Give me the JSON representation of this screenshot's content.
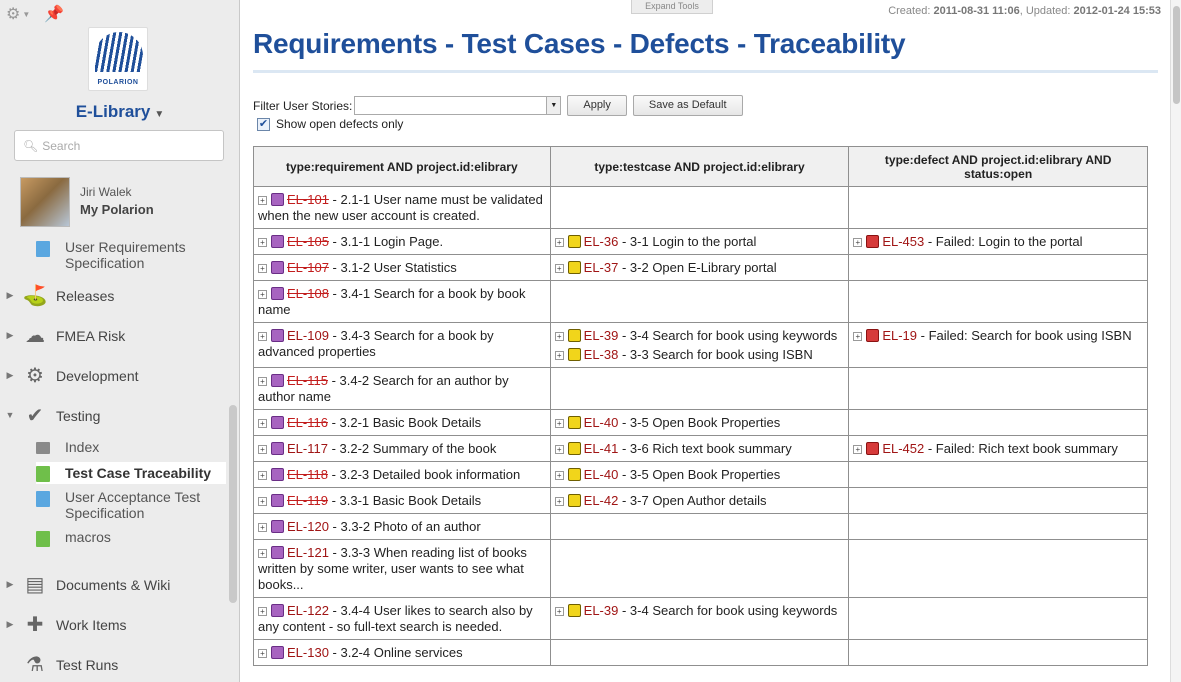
{
  "sidebar": {
    "logo_text": "POLARION",
    "project": "E-Library",
    "search_placeholder": "Search",
    "user": {
      "name": "Jiri Walek",
      "link": "My Polarion"
    },
    "nav": [
      {
        "label": "Releases"
      },
      {
        "label": "FMEA Risk"
      },
      {
        "label": "Development"
      },
      {
        "label": "Testing"
      },
      {
        "label": "Documents & Wiki"
      },
      {
        "label": "Work Items"
      },
      {
        "label": "Test Runs"
      }
    ],
    "sub": [
      {
        "label": "User Requirements Specification"
      },
      {
        "label": "Index"
      },
      {
        "label": "Test Case Traceability"
      },
      {
        "label": "User Acceptance Test Specification"
      },
      {
        "label": "macros"
      }
    ]
  },
  "header": {
    "expand_tools": "Expand Tools",
    "created_label": "Created:",
    "created": "2011-08-31 11:06",
    "updated_label": ", Updated:",
    "updated": "2012-01-24 15:53",
    "title": "Requirements - Test Cases - Defects - Traceability"
  },
  "filter": {
    "label": "Filter User Stories:",
    "value": "",
    "apply": "Apply",
    "save_default": "Save as Default",
    "checkbox_label": "Show open defects only"
  },
  "table": {
    "headers": [
      "type:requirement AND project.id:elibrary",
      "type:testcase AND project.id:elibrary",
      "type:defect AND project.id:elibrary AND status:open"
    ],
    "rows": [
      {
        "req": [
          {
            "id": "EL-101",
            "strike": true,
            "text": " - 2.1-1 User name must be validated when the new user account is created."
          }
        ],
        "tc": [],
        "def": []
      },
      {
        "req": [
          {
            "id": "EL-105",
            "strike": true,
            "text": " - 3.1-1 Login Page."
          }
        ],
        "tc": [
          {
            "id": "EL-36",
            "text": " - 3-1 Login to the portal"
          }
        ],
        "def": [
          {
            "id": "EL-453",
            "text": " - Failed: Login to the portal"
          }
        ]
      },
      {
        "req": [
          {
            "id": "EL-107",
            "strike": true,
            "text": " - 3.1-2 User Statistics"
          }
        ],
        "tc": [
          {
            "id": "EL-37",
            "text": " - 3-2 Open E-Library portal"
          }
        ],
        "def": []
      },
      {
        "req": [
          {
            "id": "EL-108",
            "strike": true,
            "text": " - 3.4-1 Search for a book by book name"
          }
        ],
        "tc": [],
        "def": []
      },
      {
        "req": [
          {
            "id": "EL-109",
            "strike": false,
            "text": " - 3.4-3 Search for a book by advanced properties"
          }
        ],
        "tc": [
          {
            "id": "EL-39",
            "text": " - 3-4 Search for book using keywords"
          },
          {
            "id": "EL-38",
            "text": " - 3-3 Search for book using ISBN"
          }
        ],
        "def": [
          {
            "id": "EL-19",
            "text": " - Failed: Search for book using ISBN"
          }
        ]
      },
      {
        "req": [
          {
            "id": "EL-115",
            "strike": true,
            "text": " - 3.4-2 Search for an author by author name"
          }
        ],
        "tc": [],
        "def": []
      },
      {
        "req": [
          {
            "id": "EL-116",
            "strike": true,
            "text": " - 3.2-1 Basic Book Details"
          }
        ],
        "tc": [
          {
            "id": "EL-40",
            "text": " - 3-5 Open Book Properties"
          }
        ],
        "def": []
      },
      {
        "req": [
          {
            "id": "EL-117",
            "strike": false,
            "text": " - 3.2-2 Summary of the book"
          }
        ],
        "tc": [
          {
            "id": "EL-41",
            "text": " - 3-6 Rich text book summary"
          }
        ],
        "def": [
          {
            "id": "EL-452",
            "text": " - Failed: Rich text book summary"
          }
        ]
      },
      {
        "req": [
          {
            "id": "EL-118",
            "strike": true,
            "text": " - 3.2-3 Detailed book information"
          }
        ],
        "tc": [
          {
            "id": "EL-40",
            "text": " - 3-5 Open Book Properties"
          }
        ],
        "def": []
      },
      {
        "req": [
          {
            "id": "EL-119",
            "strike": true,
            "text": " - 3.3-1 Basic Book Details"
          }
        ],
        "tc": [
          {
            "id": "EL-42",
            "text": " - 3-7 Open Author details"
          }
        ],
        "def": []
      },
      {
        "req": [
          {
            "id": "EL-120",
            "strike": false,
            "text": " - 3.3-2 Photo of an author"
          }
        ],
        "tc": [],
        "def": []
      },
      {
        "req": [
          {
            "id": "EL-121",
            "strike": false,
            "text": " - 3.3-3 When reading list of books written by some writer, user wants to see what books..."
          }
        ],
        "tc": [],
        "def": []
      },
      {
        "req": [
          {
            "id": "EL-122",
            "strike": false,
            "text": " - 3.4-4 User likes to search also by any content - so full-text search is needed."
          }
        ],
        "tc": [
          {
            "id": "EL-39",
            "text": " - 3-4 Search for book using keywords"
          }
        ],
        "def": []
      },
      {
        "req": [
          {
            "id": "EL-130",
            "strike": false,
            "text": " - 3.2-4 Online services"
          }
        ],
        "tc": [],
        "def": []
      }
    ]
  },
  "colors": {
    "title": "#1f4f9a",
    "id_link": "#a01515"
  }
}
